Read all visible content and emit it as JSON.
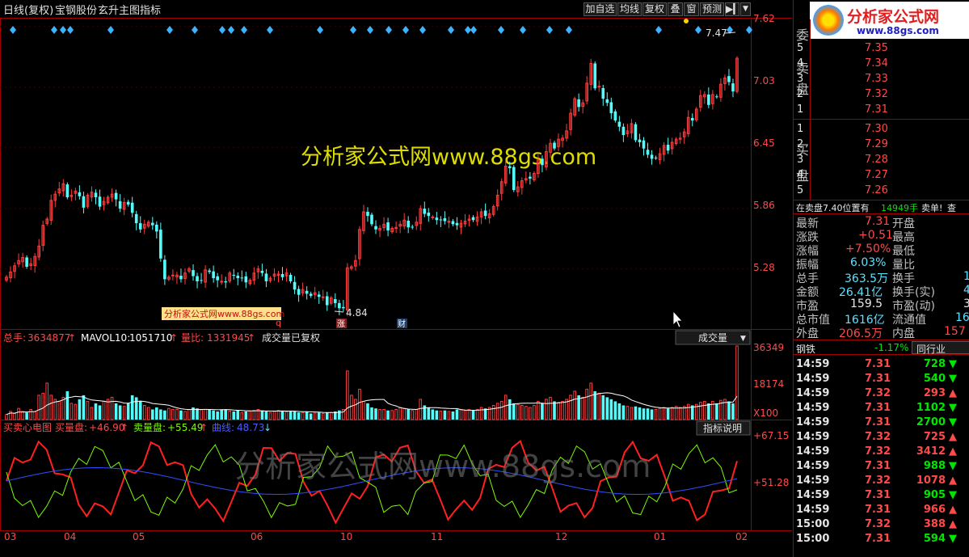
{
  "header": {
    "period": "日线(复权)",
    "stock": "宝钢股份",
    "indicator": "玄升主图指标"
  },
  "toolbar": [
    "加自选",
    "均线",
    "复权",
    "叠",
    "窗",
    "预测"
  ],
  "logo": {
    "text": "分析家公式网",
    "url": "www.88gs.com"
  },
  "watermarks": {
    "main": "分析家公式网www.88gs.com",
    "small": "分析家公式网www.88gs.com",
    "lower": "分析家公式网www.88gs.com"
  },
  "price_axis": [
    "7.62",
    "7.03",
    "6.45",
    "5.86",
    "5.28"
  ],
  "price_labels": {
    "high": "7.47",
    "low": "4.84"
  },
  "markers": {
    "m1": "q",
    "m2": "涨",
    "m3": "财"
  },
  "volume_panel": {
    "total_label": "总手:",
    "total": "3634877",
    "mavol_label": "MAVOL10:",
    "mavol": "1051710",
    "ratio_label": "量比:",
    "ratio": "1331945",
    "note": "成交量已复权",
    "button": "成交量",
    "axis": [
      "36349",
      "18174",
      "X100"
    ]
  },
  "indicator_panel": {
    "name": "买卖心电图",
    "buy_label": "买量盘:",
    "buy": "+46.90",
    "sell_label": "卖量盘:",
    "sell": "+55.49",
    "curve_label": "曲线:",
    "curve": "48.73",
    "button": "指标说明",
    "axis": [
      "+67.15",
      "+51.28"
    ]
  },
  "x_axis": [
    "03",
    "04",
    "05",
    "06",
    "10",
    "11",
    "12",
    "01",
    "02"
  ],
  "order_book": {
    "wei_label": "委",
    "sell_label": "卖盘",
    "buy_label": "买盘",
    "sells": [
      {
        "level": "5",
        "price": "7.35"
      },
      {
        "level": "4",
        "price": "7.34"
      },
      {
        "level": "3",
        "price": "7.33"
      },
      {
        "level": "2",
        "price": "7.32"
      },
      {
        "level": "1",
        "price": "7.31"
      }
    ],
    "buys": [
      {
        "level": "1",
        "price": "7.30"
      },
      {
        "level": "2",
        "price": "7.29"
      },
      {
        "level": "3",
        "price": "7.28"
      },
      {
        "level": "4",
        "price": "7.27"
      },
      {
        "level": "5",
        "price": "7.26"
      }
    ]
  },
  "notice": {
    "text": "在卖盘7.40位置有",
    "qty": "14949手",
    "tail": "卖单!",
    "more": "查"
  },
  "quote": {
    "rows": [
      {
        "l1": "最新",
        "v1": "7.31",
        "l2": "开盘",
        "c": "red"
      },
      {
        "l1": "涨跌",
        "v1": "+0.51",
        "l2": "最高",
        "c": "red"
      },
      {
        "l1": "涨幅",
        "v1": "+7.50%",
        "l2": "最低",
        "c": "red"
      },
      {
        "l1": "振幅",
        "v1": "6.03%",
        "l2": "量比",
        "c": "cyan"
      },
      {
        "l1": "总手",
        "v1": "363.5万",
        "l2": "换手",
        "v2": "1",
        "c": "cyan"
      },
      {
        "l1": "金额",
        "v1": "26.41亿",
        "l2": "换手(实)",
        "v2": "4",
        "c": "cyan"
      },
      {
        "l1": "市盈",
        "v1": "159.5",
        "l2": "市盈(动)",
        "v2": "3",
        "c": "white"
      },
      {
        "l1": "总市值",
        "v1": "1616亿",
        "l2": "流通值",
        "v2": "16",
        "c": "cyan"
      },
      {
        "l1": "外盘",
        "v1": "206.5万",
        "l2": "内盘",
        "v2": "157",
        "c": "red"
      }
    ]
  },
  "industry": {
    "name": "钢铁",
    "change": "-1.17%",
    "button": "同行业"
  },
  "trades": [
    {
      "time": "14:59",
      "price": "7.31",
      "vol": "728",
      "dir": "down"
    },
    {
      "time": "14:59",
      "price": "7.31",
      "vol": "540",
      "dir": "down"
    },
    {
      "time": "14:59",
      "price": "7.32",
      "vol": "293",
      "dir": "up"
    },
    {
      "time": "14:59",
      "price": "7.31",
      "vol": "1102",
      "dir": "down"
    },
    {
      "time": "14:59",
      "price": "7.31",
      "vol": "2700",
      "dir": "down"
    },
    {
      "time": "14:59",
      "price": "7.32",
      "vol": "725",
      "dir": "up"
    },
    {
      "time": "14:59",
      "price": "7.32",
      "vol": "3412",
      "dir": "up"
    },
    {
      "time": "14:59",
      "price": "7.31",
      "vol": "988",
      "dir": "down"
    },
    {
      "time": "14:59",
      "price": "7.32",
      "vol": "1078",
      "dir": "up"
    },
    {
      "time": "14:59",
      "price": "7.31",
      "vol": "905",
      "dir": "down"
    },
    {
      "time": "14:59",
      "price": "7.31",
      "vol": "966",
      "dir": "up"
    },
    {
      "time": "15:00",
      "price": "7.32",
      "vol": "388",
      "dir": "up"
    },
    {
      "time": "15:00",
      "price": "7.31",
      "vol": "594",
      "dir": "down"
    }
  ],
  "colors": {
    "up": "#ff3c3c",
    "down": "#54fcfc",
    "bg": "#000000",
    "border": "#a00000",
    "diamond": "#3cb4ff",
    "title": "#ffff00"
  },
  "chart_data": {
    "type": "candlestick",
    "ylim": [
      4.7,
      7.7
    ],
    "closes": [
      5.2,
      5.25,
      5.31,
      5.36,
      5.39,
      5.3,
      5.33,
      5.4,
      5.5,
      5.7,
      5.76,
      5.94,
      6.0,
      6.05,
      6.1,
      5.97,
      5.99,
      6.03,
      5.98,
      5.87,
      5.99,
      6.02,
      5.97,
      5.88,
      5.93,
      5.97,
      6.0,
      5.95,
      5.86,
      5.92,
      5.9,
      5.82,
      5.72,
      5.66,
      5.71,
      5.73,
      5.7,
      5.64,
      5.38,
      5.18,
      5.2,
      5.22,
      5.22,
      5.18,
      5.24,
      5.28,
      5.21,
      5.16,
      5.17,
      5.27,
      5.25,
      5.19,
      5.17,
      5.16,
      5.15,
      5.24,
      5.22,
      5.19,
      5.19,
      5.15,
      5.17,
      5.24,
      5.28,
      5.24,
      5.16,
      5.19,
      5.23,
      5.23,
      5.2,
      5.24,
      5.16,
      5.08,
      5.03,
      5.08,
      5.04,
      5.02,
      5.05,
      5.01,
      5.01,
      4.93,
      5.0,
      4.95,
      4.9,
      4.9,
      5.29,
      5.3,
      5.36,
      5.66,
      5.83,
      5.79,
      5.71,
      5.66,
      5.67,
      5.71,
      5.65,
      5.67,
      5.68,
      5.71,
      5.75,
      5.68,
      5.68,
      5.73,
      5.86,
      5.81,
      5.79,
      5.78,
      5.75,
      5.75,
      5.74,
      5.74,
      5.71,
      5.7,
      5.72,
      5.74,
      5.76,
      5.75,
      5.78,
      5.83,
      5.79,
      5.81,
      5.88,
      5.99,
      6.12,
      6.27,
      6.25,
      6.04,
      6.07,
      6.13,
      6.15,
      6.15,
      6.2,
      6.33,
      6.28,
      6.41,
      6.49,
      6.44,
      6.53,
      6.54,
      6.61,
      6.78,
      6.92,
      6.84,
      6.88,
      7.07,
      7.26,
      7.02,
      7.04,
      6.92,
      6.88,
      6.78,
      6.71,
      6.65,
      6.57,
      6.61,
      6.68,
      6.52,
      6.5,
      6.44,
      6.38,
      6.34,
      6.35,
      6.39,
      6.47,
      6.42,
      6.5,
      6.53,
      6.54,
      6.6,
      6.74,
      6.71,
      6.82,
      6.95,
      6.96,
      6.86,
      6.96,
      6.94,
      7.06,
      7.12,
      7.08,
      6.99,
      7.31
    ],
    "volumes": [
      2.5,
      4.0,
      3.0,
      5.5,
      4.0,
      3.5,
      5.0,
      4.0,
      12.0,
      13.0,
      18.0,
      12.0,
      10.0,
      9.0,
      11.0,
      14.0,
      8.0,
      7.5,
      10.0,
      12.0,
      9.0,
      6.0,
      8.0,
      7.0,
      9.0,
      10.0,
      11.0,
      8.0,
      7.0,
      6.5,
      8.0,
      12.0,
      11.0,
      9.0,
      7.0,
      6.0,
      5.0,
      6.0,
      5.0,
      4.5,
      5.5,
      5.0,
      5.0,
      4.5,
      4.0,
      5.0,
      6.0,
      5.5,
      4.8,
      5.0,
      5.0,
      4.5,
      4.0,
      5.0,
      4.8,
      4.2,
      4.0,
      4.5,
      3.5,
      4.0,
      4.2,
      4.5,
      5.0,
      4.5,
      4.0,
      3.5,
      4.0,
      4.5,
      4.0,
      3.8,
      4.0,
      4.0,
      3.5,
      3.5,
      4.0,
      3.0,
      3.2,
      3.5,
      3.0,
      3.5,
      3.5,
      4.0,
      4.5,
      5.0,
      24.0,
      12.0,
      10.0,
      15.0,
      9.0,
      8.0,
      6.0,
      5.5,
      5.0,
      5.0,
      4.5,
      4.5,
      5.0,
      6.0,
      5.5,
      5.0,
      4.5,
      5.0,
      10.0,
      7.0,
      6.0,
      5.0,
      4.5,
      4.2,
      4.5,
      4.0,
      4.0,
      5.0,
      5.0,
      4.5,
      5.0,
      4.8,
      5.0,
      6.0,
      5.5,
      6.0,
      7.0,
      8.0,
      9.0,
      12.0,
      10.0,
      8.0,
      7.5,
      7.0,
      6.5,
      6.0,
      7.0,
      9.0,
      8.0,
      10.0,
      11.0,
      9.0,
      8.5,
      9.0,
      10.0,
      12.0,
      14.0,
      12.0,
      11.0,
      15.0,
      18.0,
      14.0,
      13.0,
      12.0,
      11.0,
      10.0,
      9.0,
      8.0,
      7.0,
      6.5,
      6.0,
      6.5,
      6.0,
      5.5,
      5.5,
      5.0,
      5.0,
      5.5,
      6.0,
      5.5,
      6.0,
      6.5,
      6.0,
      6.5,
      7.5,
      7.0,
      7.5,
      8.5,
      9.0,
      8.0,
      9.0,
      8.0,
      9.5,
      10.0,
      9.0,
      8.0,
      36.3
    ]
  }
}
